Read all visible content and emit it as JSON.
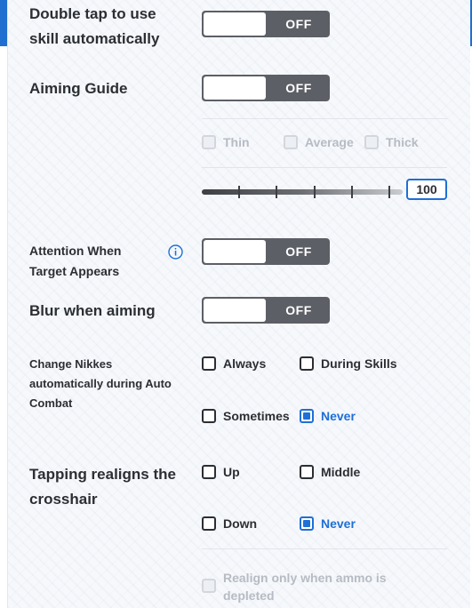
{
  "settings": {
    "double_tap": {
      "label_line1": "Double tap to use",
      "label_line2": "skill automatically",
      "state": "OFF"
    },
    "aiming_guide": {
      "label": "Aiming Guide",
      "state": "OFF",
      "thickness_options": [
        "Thin",
        "Average",
        "Thick"
      ],
      "opacity_value": "100"
    },
    "attention": {
      "label_line1": "Attention When",
      "label_line2": "Target Appears",
      "state": "OFF"
    },
    "blur": {
      "label": "Blur when aiming",
      "state": "OFF"
    },
    "change_nikkes": {
      "label_line1": "Change Nikkes",
      "label_line2": "automatically during Auto",
      "label_line3": "Combat",
      "options": [
        "Always",
        "During Skills",
        "Sometimes",
        "Never"
      ],
      "selected": "Never"
    },
    "tapping_realigns": {
      "label_line1": "Tapping realigns the",
      "label_line2": "crosshair",
      "options": [
        "Up",
        "Middle",
        "Down",
        "Never"
      ],
      "selected": "Never",
      "ammo_option_line1": "Realign only when ammo is",
      "ammo_option_line2": "depleted"
    }
  },
  "colors": {
    "accent": "#1e6fd6",
    "toggle_off": "#5c5f65",
    "panel": "#f6f8fb"
  }
}
